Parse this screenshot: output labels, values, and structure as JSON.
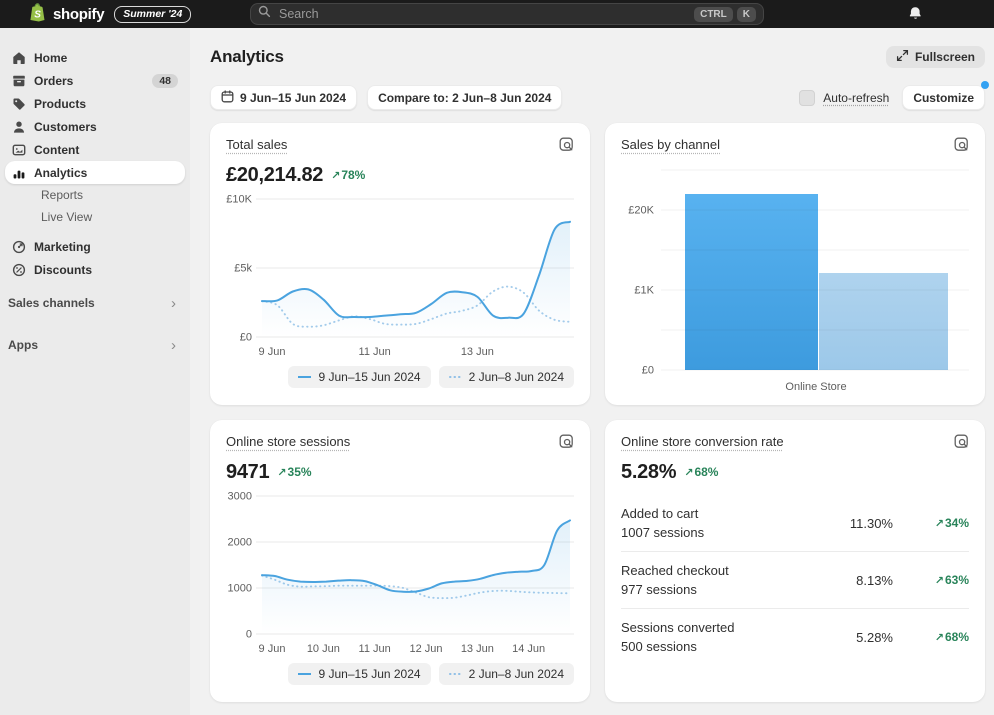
{
  "topbar": {
    "brand": "shopify",
    "version_badge": "Summer '24",
    "search_placeholder": "Search",
    "shortcut_keys": [
      "CTRL",
      "K"
    ]
  },
  "sidebar": {
    "items": [
      {
        "label": "Home"
      },
      {
        "label": "Orders",
        "badge": "48"
      },
      {
        "label": "Products"
      },
      {
        "label": "Customers"
      },
      {
        "label": "Content"
      },
      {
        "label": "Analytics",
        "active": true
      },
      {
        "label": "Reports"
      },
      {
        "label": "Live View"
      },
      {
        "label": "Marketing"
      },
      {
        "label": "Discounts"
      }
    ],
    "sections": [
      {
        "label": "Sales channels"
      },
      {
        "label": "Apps"
      }
    ]
  },
  "header": {
    "title": "Analytics",
    "fullscreen_label": "Fullscreen",
    "date_range": "9 Jun–15 Jun 2024",
    "compare_label": "Compare to: 2 Jun–8 Jun 2024",
    "auto_refresh_label": "Auto-refresh",
    "customize_label": "Customize"
  },
  "legend": {
    "current": "9 Jun–15 Jun 2024",
    "previous": "2 Jun–8 Jun 2024"
  },
  "icons": {
    "trend_up": "↗",
    "chevron_right": "›"
  },
  "colors": {
    "accent_blue": "#4AA3DF",
    "compare_blue": "#A5CCEB",
    "success_green": "#29845A",
    "bar_top": "#58B2F0",
    "bar_bottom": "#3D9BDE",
    "compare_bar_top": "#AFD3EE",
    "compare_bar_bottom": "#9CC8E9"
  },
  "cards": {
    "total_sales": {
      "title": "Total sales",
      "value": "£20,214.82",
      "delta": "78%"
    },
    "sales_by_channel": {
      "title": "Sales by channel"
    },
    "sessions": {
      "title": "Online store sessions",
      "value": "9471",
      "delta": "35%"
    },
    "conversion": {
      "title": "Online store conversion rate",
      "value": "5.28%",
      "delta": "68%",
      "rows": [
        {
          "label": "Added to cart",
          "sublabel": "1007 sessions",
          "rate": "11.30%",
          "delta": "34%"
        },
        {
          "label": "Reached checkout",
          "sublabel": "977 sessions",
          "rate": "8.13%",
          "delta": "63%"
        },
        {
          "label": "Sessions converted",
          "sublabel": "500 sessions",
          "rate": "5.28%",
          "delta": "68%"
        }
      ]
    }
  },
  "chart_data": [
    {
      "id": "total-sales-chart",
      "type": "line",
      "title": "Total sales",
      "ymax": 10000,
      "yticks": [
        "£10K",
        "£5k",
        "£0"
      ],
      "xticks": [
        "9 Jun",
        "11 Jun",
        "13 Jun"
      ],
      "grid": true,
      "legend_position": "bottom-right",
      "series": [
        {
          "name": "9 Jun–15 Jun 2024",
          "style": "solid",
          "values": [
            2600,
            2650,
            3300,
            3450,
            2700,
            1550,
            1450,
            1450,
            1550,
            1650,
            1750,
            2400,
            3200,
            3250,
            2900,
            1550,
            1400,
            1700,
            4500,
            7800,
            8350
          ]
        },
        {
          "name": "2 Jun–8 Jun 2024",
          "style": "dotted",
          "values": [
            2600,
            2300,
            950,
            750,
            850,
            1200,
            1500,
            1300,
            950,
            900,
            950,
            1300,
            1700,
            1900,
            2300,
            3300,
            3650,
            3200,
            1900,
            1250,
            1100
          ]
        }
      ]
    },
    {
      "id": "sales-by-channel-chart",
      "type": "bar",
      "title": "Sales by channel",
      "categories": [
        "Online Store"
      ],
      "yticks": [
        {
          "label": "£20K",
          "grid": 1
        },
        {
          "label": "£1K",
          "grid": 3
        },
        {
          "label": "£0",
          "grid": 5
        }
      ],
      "series": [
        {
          "name": "9 Jun–15 Jun 2024",
          "value": 20214.82,
          "height_frac": 0.88
        },
        {
          "name": "2 Jun–8 Jun 2024",
          "value": 11300,
          "height_frac": 0.485
        }
      ]
    },
    {
      "id": "sessions-chart",
      "type": "line",
      "title": "Online store sessions",
      "ymax": 3000,
      "yticks": [
        "3000",
        "2000",
        "1000",
        "0"
      ],
      "xticks": [
        "9 Jun",
        "10 Jun",
        "11 Jun",
        "12 Jun",
        "13 Jun",
        "14 Jun"
      ],
      "grid": true,
      "legend_position": "bottom-right",
      "series": [
        {
          "name": "9 Jun–15 Jun 2024",
          "style": "solid",
          "values": [
            1280,
            1260,
            1180,
            1140,
            1130,
            1140,
            1160,
            1170,
            1150,
            1060,
            950,
            920,
            925,
            990,
            1100,
            1140,
            1155,
            1200,
            1280,
            1330,
            1355,
            1370,
            1500,
            2250,
            2470
          ]
        },
        {
          "name": "2 Jun–8 Jun 2024",
          "style": "dotted",
          "values": [
            1270,
            1180,
            1070,
            1030,
            1035,
            1040,
            1050,
            1050,
            1050,
            1050,
            1040,
            1000,
            900,
            800,
            780,
            790,
            840,
            900,
            935,
            940,
            920,
            905,
            895,
            890,
            885
          ]
        }
      ]
    }
  ]
}
